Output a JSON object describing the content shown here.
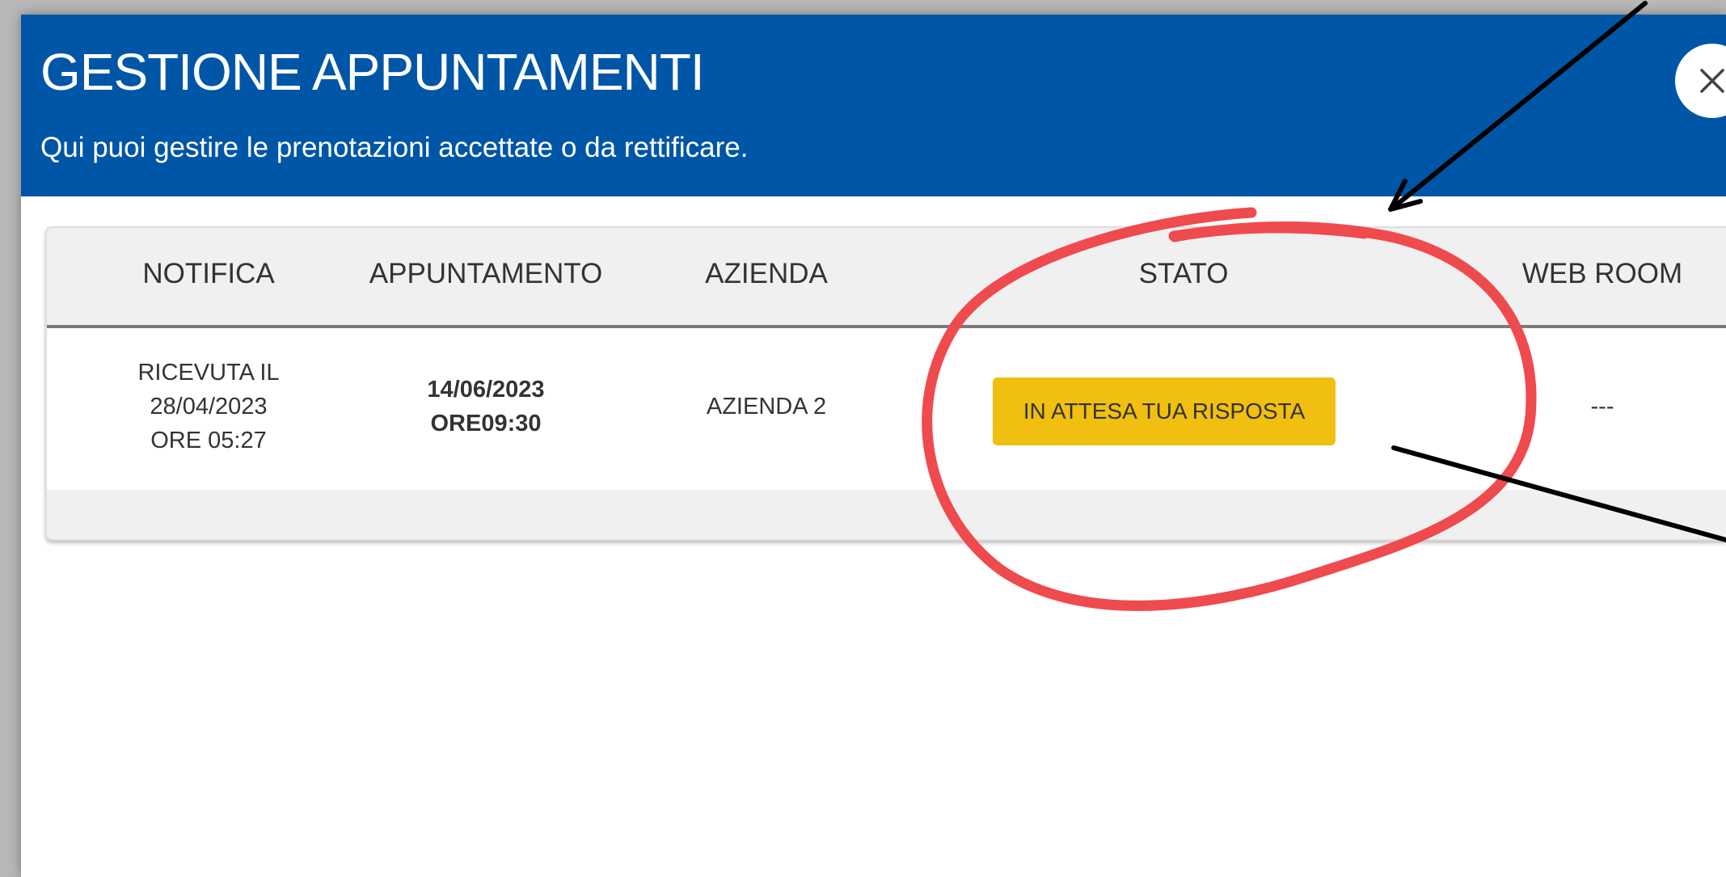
{
  "modal": {
    "title": "GESTIONE APPUNTAMENTI",
    "subtitle": "Qui puoi gestire le prenotazioni accettate o da rettificare."
  },
  "table": {
    "headers": [
      "NOTIFICA",
      "APPUNTAMENTO",
      "AZIENDA",
      "STATO",
      "WEB ROOM"
    ],
    "rows": [
      {
        "notifica": [
          "RICEVUTA IL",
          "28/04/2023",
          "ORE 05:27"
        ],
        "appuntamento": [
          "14/06/2023",
          "ORE09:30"
        ],
        "azienda": "AZIENDA 2",
        "stato": "IN ATTESA TUA RISPOSTA",
        "web_room": "---"
      }
    ]
  },
  "icons": {
    "close": "close-icon"
  },
  "colors": {
    "header_blue": "#0056a6",
    "status_yellow": "#f0bf0f",
    "annotation_red": "#ef4a4e",
    "annotation_black": "#000000"
  }
}
